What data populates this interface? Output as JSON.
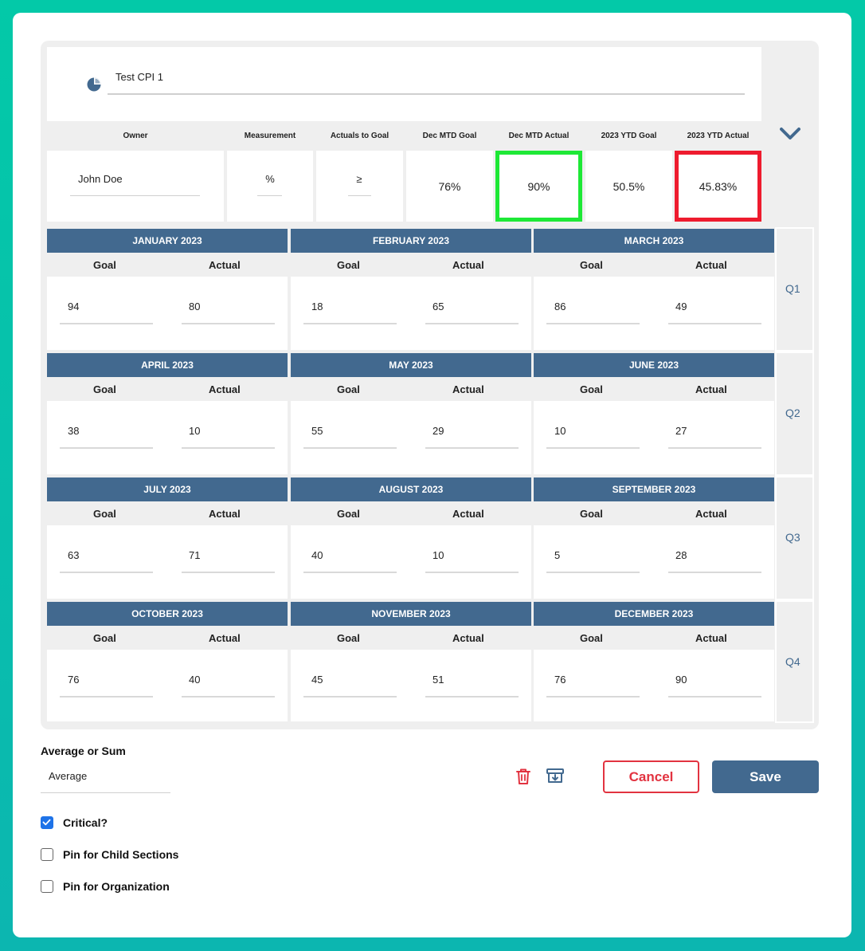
{
  "kpi": {
    "title": "Test CPI 1"
  },
  "headers": {
    "owner": "Owner",
    "measurement": "Measurement",
    "actuals_to_goal": "Actuals to Goal",
    "dec_mtd_goal": "Dec MTD Goal",
    "dec_mtd_actual": "Dec MTD Actual",
    "ytd_goal": "2023 YTD Goal",
    "ytd_actual": "2023 YTD Actual"
  },
  "summary": {
    "owner": "John Doe",
    "measurement": "%",
    "actuals_to_goal": "≥",
    "dec_mtd_goal": "76%",
    "dec_mtd_actual": "90%",
    "ytd_goal": "50.5%",
    "ytd_actual": "45.83%"
  },
  "status_colors": {
    "good": "#1ee836",
    "bad": "#ee1b2e",
    "primary": "#42698f"
  },
  "col_labels": {
    "goal": "Goal",
    "actual": "Actual"
  },
  "quarters": [
    {
      "label": "Q1",
      "months": [
        {
          "name": "JANUARY 2023",
          "goal": "94",
          "actual": "80"
        },
        {
          "name": "FEBRUARY 2023",
          "goal": "18",
          "actual": "65"
        },
        {
          "name": "MARCH 2023",
          "goal": "86",
          "actual": "49"
        }
      ]
    },
    {
      "label": "Q2",
      "months": [
        {
          "name": "APRIL 2023",
          "goal": "38",
          "actual": "10"
        },
        {
          "name": "MAY 2023",
          "goal": "55",
          "actual": "29"
        },
        {
          "name": "JUNE 2023",
          "goal": "10",
          "actual": "27"
        }
      ]
    },
    {
      "label": "Q3",
      "months": [
        {
          "name": "JULY 2023",
          "goal": "63",
          "actual": "71"
        },
        {
          "name": "AUGUST 2023",
          "goal": "40",
          "actual": "10"
        },
        {
          "name": "SEPTEMBER 2023",
          "goal": "5",
          "actual": "28"
        }
      ]
    },
    {
      "label": "Q4",
      "months": [
        {
          "name": "OCTOBER 2023",
          "goal": "76",
          "actual": "40"
        },
        {
          "name": "NOVEMBER 2023",
          "goal": "45",
          "actual": "51"
        },
        {
          "name": "DECEMBER 2023",
          "goal": "76",
          "actual": "90"
        }
      ]
    }
  ],
  "aggregation": {
    "label": "Average or Sum",
    "value": "Average"
  },
  "icons": {
    "delete": "trash-icon",
    "archive": "archive-icon",
    "kpi": "pie-chart-icon",
    "expand": "chevron-down-icon"
  },
  "buttons": {
    "cancel": "Cancel",
    "save": "Save"
  },
  "checkboxes": [
    {
      "label": "Critical?",
      "checked": true
    },
    {
      "label": "Pin for Child Sections",
      "checked": false
    },
    {
      "label": "Pin for Organization",
      "checked": false
    }
  ]
}
